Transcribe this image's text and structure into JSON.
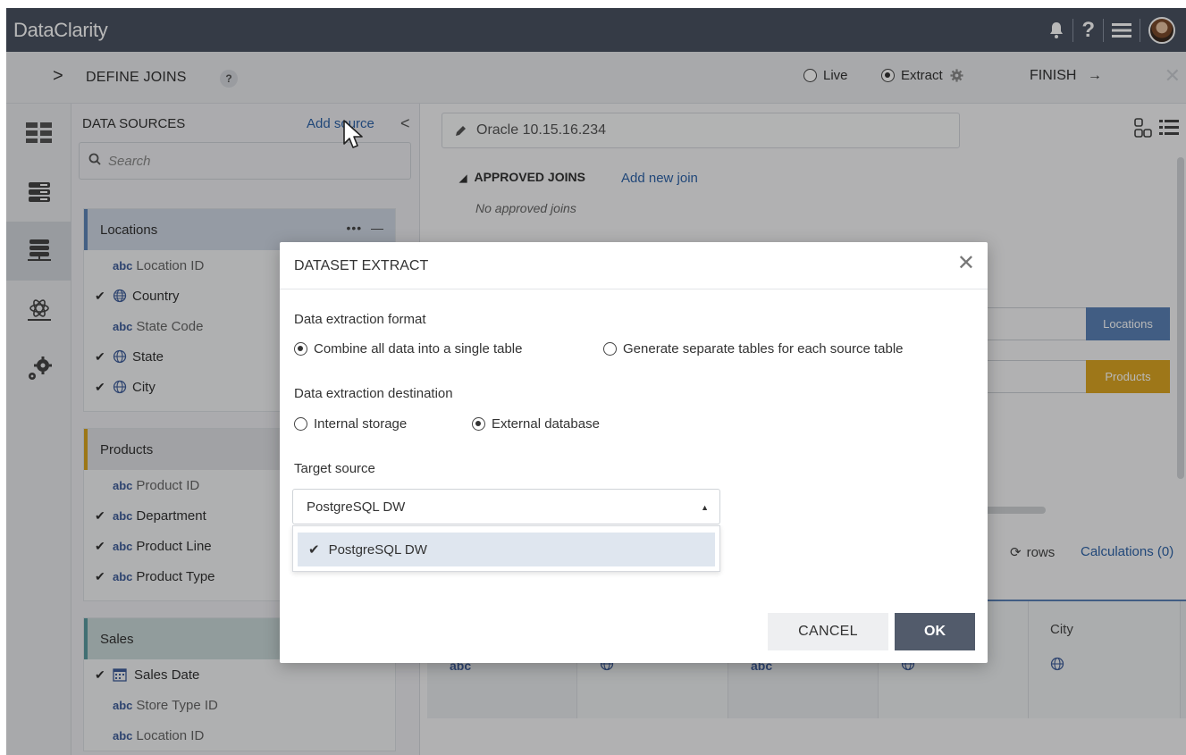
{
  "app": {
    "brand": "DataClarity"
  },
  "header_icons": [
    "bell-icon",
    "help-icon",
    "menu-icon",
    "avatar"
  ],
  "subbar": {
    "title": "DEFINE JOINS",
    "help": "?",
    "mode_live": "Live",
    "mode_extract": "Extract",
    "selected_mode": "Extract",
    "finish": "FINISH",
    "expand_arrow": ">"
  },
  "data_sources": {
    "title": "DATA SOURCES",
    "add_source": "Add source",
    "search_placeholder": "Search",
    "tables": [
      {
        "name": "Locations",
        "tools": "•••",
        "fields": [
          {
            "type": "abc",
            "label": "Location ID",
            "selected": false
          },
          {
            "type": "geo",
            "label": "Country",
            "selected": true
          },
          {
            "type": "abc",
            "label": "State Code",
            "selected": false
          },
          {
            "type": "geo",
            "label": "State",
            "selected": true
          },
          {
            "type": "geo",
            "label": "City",
            "selected": true
          }
        ]
      },
      {
        "name": "Products",
        "fields": [
          {
            "type": "abc",
            "label": "Product ID",
            "selected": false
          },
          {
            "type": "abc",
            "label": "Department",
            "selected": true
          },
          {
            "type": "abc",
            "label": "Product Line",
            "selected": true
          },
          {
            "type": "abc",
            "label": "Product Type",
            "selected": true
          }
        ]
      },
      {
        "name": "Sales",
        "fields": [
          {
            "type": "date",
            "label": "Sales Date",
            "selected": true
          },
          {
            "type": "abc",
            "label": "Store Type ID",
            "selected": false
          },
          {
            "type": "abc",
            "label": "Location ID",
            "selected": false
          }
        ]
      }
    ]
  },
  "main": {
    "source_name": "Oracle 10.15.16.234",
    "approved_joins": "APPROVED JOINS",
    "add_new_join": "Add new join",
    "no_joins": "No approved joins",
    "chip_locations": "Locations",
    "chip_products": "Products",
    "rows": "rows",
    "calculations": "Calculations (0)",
    "grid_city": "City",
    "abc": "abc"
  },
  "modal": {
    "title": "DATASET EXTRACT",
    "format_label": "Data extraction format",
    "format_options": [
      "Combine all data into a single table",
      "Generate separate tables for each source table"
    ],
    "format_selected": "Combine all data into a single table",
    "destination_label": "Data extraction destination",
    "destination_options": [
      "Internal storage",
      "External database"
    ],
    "destination_selected": "External database",
    "target_label": "Target source",
    "target_value": "PostgreSQL DW",
    "dropdown_options": [
      "PostgreSQL DW"
    ],
    "cancel": "CANCEL",
    "ok": "OK"
  },
  "colors": {
    "topbar": "#4a5362",
    "link": "#2e63a8",
    "locations": "#5a82b6",
    "products": "#dba623",
    "ok_button": "#525b6b"
  }
}
